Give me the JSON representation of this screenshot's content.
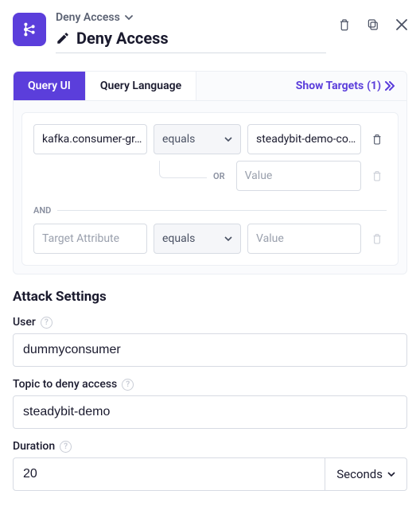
{
  "header": {
    "breadcrumb_label": "Deny Access",
    "title": "Deny Access"
  },
  "tabs": {
    "query_ui": "Query UI",
    "query_language": "Query Language"
  },
  "show_targets": {
    "label": "Show Targets",
    "count": "(1)"
  },
  "query": {
    "row1_attr": "kafka.consumer-gr…",
    "row1_op": "equals",
    "row1_val": "steadybit-demo-co…",
    "or_label": "OR",
    "or_val_placeholder": "Value",
    "and_label": "AND",
    "row3_attr_placeholder": "Target Attribute",
    "row3_op": "equals",
    "row3_val_placeholder": "Value"
  },
  "settings": {
    "heading": "Attack Settings",
    "user_label": "User",
    "user_value": "dummyconsumer",
    "topic_label": "Topic to deny access",
    "topic_value": "steadybit-demo",
    "duration_label": "Duration",
    "duration_value": "20",
    "duration_unit": "Seconds"
  }
}
